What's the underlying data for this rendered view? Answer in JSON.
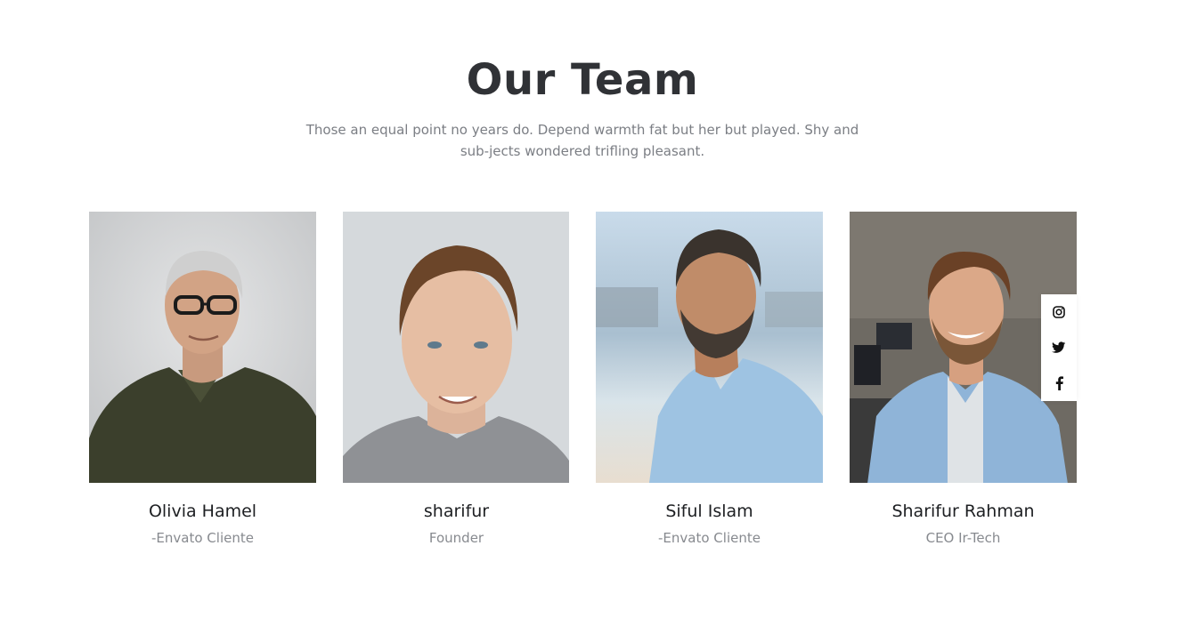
{
  "section": {
    "title": "Our Team",
    "subtitle": "Those an equal point no years do. Depend warmth fat but her but played. Shy and sub-jects wondered trifling pleasant."
  },
  "members": [
    {
      "name": "Olivia Hamel",
      "role": "-Envato Cliente",
      "photo": "man-glasses-green-polo"
    },
    {
      "name": "sharifur",
      "role": "Founder",
      "photo": "young-man-grey-tshirt"
    },
    {
      "name": "Siful Islam",
      "role": "-Envato Cliente",
      "photo": "bearded-man-blue-shirt-harbor"
    },
    {
      "name": "Sharifur Rahman",
      "role": "CEO Ir-Tech",
      "photo": "smiling-man-denim-shirt-office"
    }
  ],
  "social_icons": [
    "instagram-icon",
    "twitter-icon",
    "facebook-icon"
  ],
  "colors": {
    "title": "#303236",
    "subtitle": "#7b7e84",
    "name": "#1d1f22",
    "role": "#878a8f"
  }
}
